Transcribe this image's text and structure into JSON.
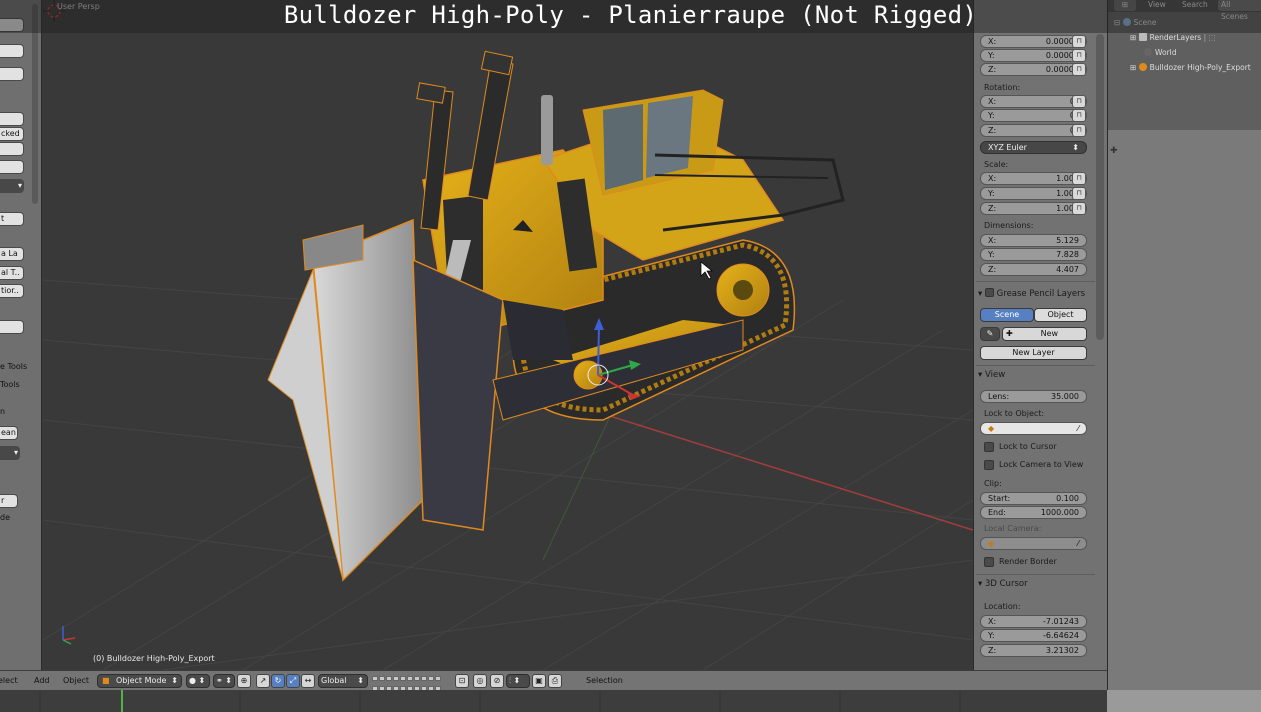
{
  "overlay_title": "Bulldozer High-Poly - Planierraupe (Not Rigged)",
  "viewport": {
    "view_label": "User Persp",
    "active_object_label": "(0) Bulldozer High-Poly_Export",
    "object_selection_color": "#e08a1e",
    "grid_x_axis_color": "#a33d3d"
  },
  "toolshelf": {
    "fragments": [
      "cked",
      "t",
      "a La",
      "al T..",
      "tior..",
      "e Tools",
      "Tools",
      "n",
      "ean",
      "r",
      "de"
    ]
  },
  "properties": {
    "location": {
      "x": "0.00000",
      "y": "0.00000",
      "z": "0.00000"
    },
    "rotation_label": "Rotation:",
    "rotation": {
      "x": "0°",
      "y": "0°",
      "z": "0°"
    },
    "rotation_mode": "XYZ Euler",
    "scale_label": "Scale:",
    "scale": {
      "x": "1.000",
      "y": "1.000",
      "z": "1.000"
    },
    "dimensions_label": "Dimensions:",
    "dimensions": {
      "x": "5.129",
      "y": "7.828",
      "z": "4.407"
    },
    "grease_pencil": {
      "title": "Grease Pencil Layers",
      "tab_scene": "Scene",
      "tab_object": "Object",
      "new_label": "New",
      "new_layer_label": "New Layer"
    },
    "view": {
      "title": "View",
      "lens_label": "Lens:",
      "lens_value": "35.000",
      "lock_to_object_label": "Lock to Object:",
      "lock_to_cursor_label": "Lock to Cursor",
      "lock_camera_label": "Lock Camera to View",
      "clip_label": "Clip:",
      "clip_start_label": "Start:",
      "clip_start": "0.100",
      "clip_end_label": "End:",
      "clip_end": "1000.000",
      "local_camera_label": "Local Camera:",
      "render_border_label": "Render Border"
    },
    "cursor": {
      "title": "3D Cursor",
      "location_label": "Location:",
      "x": "-7.01243",
      "y": "-6.64624",
      "z": "3.21302"
    }
  },
  "outliner": {
    "header": {
      "view": "View",
      "search": "Search",
      "scenes": "All Scenes"
    },
    "items": [
      "Scene",
      "RenderLayers",
      "World",
      "Bulldozer High-Poly_Export"
    ]
  },
  "bottom": {
    "menus": [
      "elect",
      "Add",
      "Object"
    ],
    "mode": "Object Mode",
    "orientation": "Global",
    "selection_label": "Selection"
  }
}
